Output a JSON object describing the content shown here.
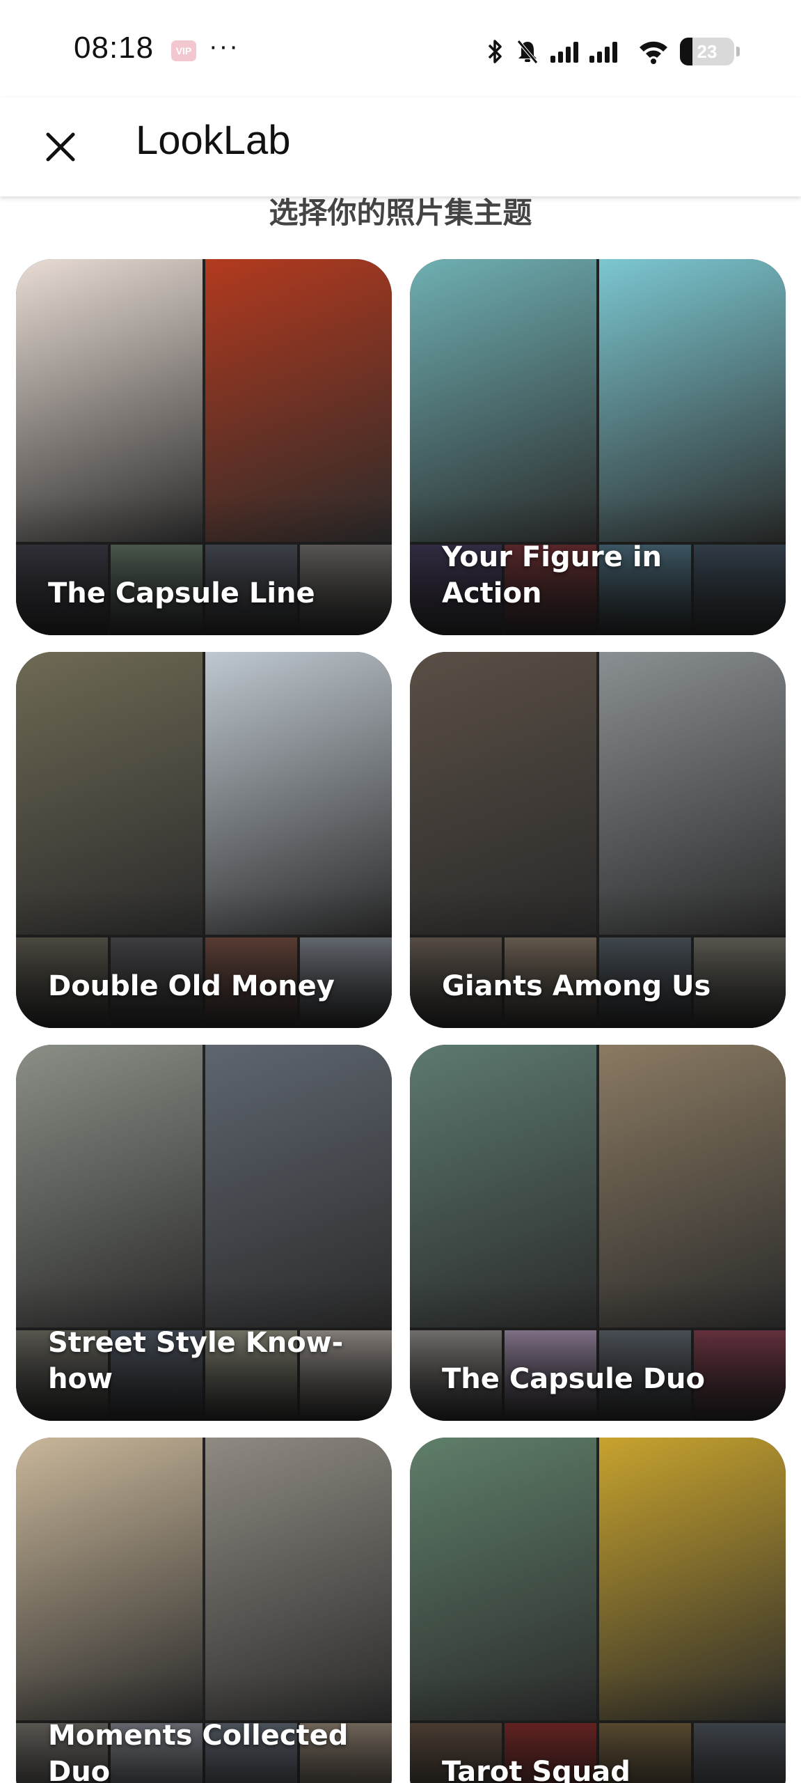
{
  "status_bar": {
    "time": "08:18",
    "badge": "VIP",
    "dots": "···",
    "icons": [
      "bluetooth-icon",
      "mute-bell-icon",
      "signal-icon",
      "wifi-icon",
      "battery-icon"
    ],
    "battery_level": "23",
    "battery_fraction": 0.23
  },
  "app_bar": {
    "close_icon": "close-icon",
    "title": "LookLab"
  },
  "section": {
    "title": "选择你的照片集主题"
  },
  "themes": [
    {
      "label": "The Capsule Line",
      "photos": [
        "#e9ddd5",
        "#b33a1f"
      ],
      "thumbs": [
        "#3b3a44",
        "#5a6b5e",
        "#4a4f58",
        "#6d6a66"
      ]
    },
    {
      "label": "Your Figure in Action",
      "photos": [
        "#6fb0b3",
        "#7cc7d1"
      ],
      "thumbs": [
        "#3f3552",
        "#6b2f33",
        "#4a6a7a",
        "#3c4a58"
      ]
    },
    {
      "label": "Double Old Money",
      "photos": [
        "#6f6a55",
        "#bfc8d0"
      ],
      "thumbs": [
        "#5d5a4f",
        "#4c4b4f",
        "#6e4a3f",
        "#7a8089"
      ]
    },
    {
      "label": "Giants Among Us",
      "photos": [
        "#5a4f45",
        "#8a8f92"
      ],
      "thumbs": [
        "#6a5f55",
        "#7b6d5e",
        "#4f5860",
        "#6c6a60"
      ]
    },
    {
      "label": "Street Style Know-how",
      "photos": [
        "#8a8f86",
        "#5f6670"
      ],
      "thumbs": [
        "#6c6a61",
        "#4f5763",
        "#8b8a7a",
        "#a29a94"
      ]
    },
    {
      "label": "The Capsule Duo",
      "photos": [
        "#5d7a70",
        "#8a7a62"
      ],
      "thumbs": [
        "#8a8784",
        "#9c8aa5",
        "#5a6068",
        "#7a3b4a"
      ]
    },
    {
      "label": "Moments Collected Duo",
      "photos": [
        "#c9b79a",
        "#8f8a82"
      ],
      "thumbs": [
        "#6e6a64",
        "#7a7f86",
        "#5d6570",
        "#8a7c6d"
      ]
    },
    {
      "label": "Tarot Squad",
      "photos": [
        "#5f7f6a",
        "#c8a32e"
      ],
      "thumbs": [
        "#5a4a3c",
        "#7a2a28",
        "#6b5a3a",
        "#4a5058"
      ]
    }
  ]
}
